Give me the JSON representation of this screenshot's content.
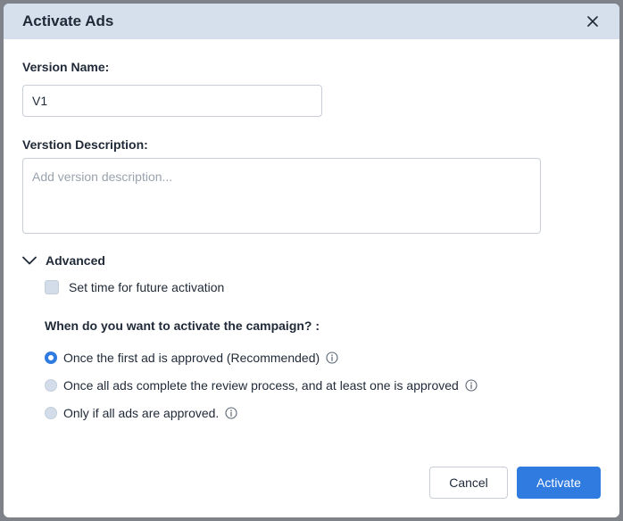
{
  "dialog": {
    "title": "Activate Ads"
  },
  "form": {
    "version_name_label": "Version Name:",
    "version_name_value": "V1",
    "version_description_label": "Verstion Description:",
    "version_description_placeholder": "Add version description...",
    "version_description_value": ""
  },
  "advanced": {
    "label": "Advanced",
    "expanded": true,
    "future_activation_label": "Set time for future activation",
    "future_activation_checked": false,
    "question": "When do you want to activate the campaign? :",
    "options": [
      {
        "label": "Once the first ad is approved (Recommended)",
        "selected": true
      },
      {
        "label": "Once all ads complete the review process, and at least one is approved",
        "selected": false
      },
      {
        "label": "Only if all ads are approved.",
        "selected": false
      }
    ]
  },
  "buttons": {
    "cancel": "Cancel",
    "activate": "Activate"
  },
  "colors": {
    "header_bg": "#d5e0ec",
    "primary": "#2f7be0",
    "text": "#1f2937"
  }
}
